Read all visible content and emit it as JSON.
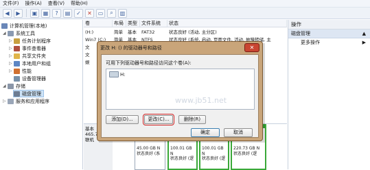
{
  "menu": [
    "文件(F)",
    "操作(A)",
    "查看(V)",
    "帮助(H)"
  ],
  "toolbar_icons": [
    "back-icon",
    "forward-icon",
    "up-icon",
    "grid-icon",
    "help-icon",
    "properties-icon",
    "check-icon",
    "delete-icon",
    "open-icon",
    "search-icon",
    "view-icon"
  ],
  "tree": {
    "root": "计算机管理(本地)",
    "system_tools": "系统工具",
    "task_scheduler": "任务计划程序",
    "event_viewer": "事件查看器",
    "shared_folders": "共享文件夹",
    "local_users": "本地用户和组",
    "performance": "性能",
    "device_manager": "设备管理器",
    "storage": "存储",
    "disk_management": "磁盘管理",
    "services": "服务和应用程序"
  },
  "volumes": {
    "headers": [
      "卷",
      "布局",
      "类型",
      "文件系统",
      "状态"
    ],
    "rows": [
      [
        "(H:)",
        "简单",
        "基本",
        "FAT32",
        "状态良好 (活动, 主分区)"
      ],
      [
        "Win7 (C:)",
        "简单",
        "基本",
        "NTFS",
        "状态良好 (系统, 启动, 页面文件, 活动, 故障转储, 主"
      ],
      [
        "文",
        "",
        "",
        "",
        ""
      ],
      [
        "文",
        "",
        "",
        "",
        ""
      ],
      [
        "娱",
        "",
        "",
        "",
        ""
      ]
    ]
  },
  "actions": {
    "header": "操作",
    "section": "磁盘管理",
    "more": "更多操作"
  },
  "disk": {
    "name": "基本",
    "size": "465.76 GB",
    "status": "联机",
    "vols": [
      {
        "size": "45.00 GB N",
        "status": "状态良好 (系"
      },
      {
        "size": "100.01 GB N",
        "status": "状态良好 (逻"
      },
      {
        "size": "100.01 GB N",
        "status": "状态良好 (逻"
      },
      {
        "size": "220.73 GB N",
        "status": "状态良好 (逻"
      }
    ]
  },
  "dialog": {
    "title": "更改 H: () 的驱动器号和路径",
    "label": "可用下列驱动器号和路径访问这个卷(A):",
    "item": "H:",
    "add": "添加(D)...",
    "change": "更改(C)...",
    "remove": "删除(R)",
    "ok": "确定",
    "cancel": "取消"
  },
  "watermark": "www.jb51.net"
}
